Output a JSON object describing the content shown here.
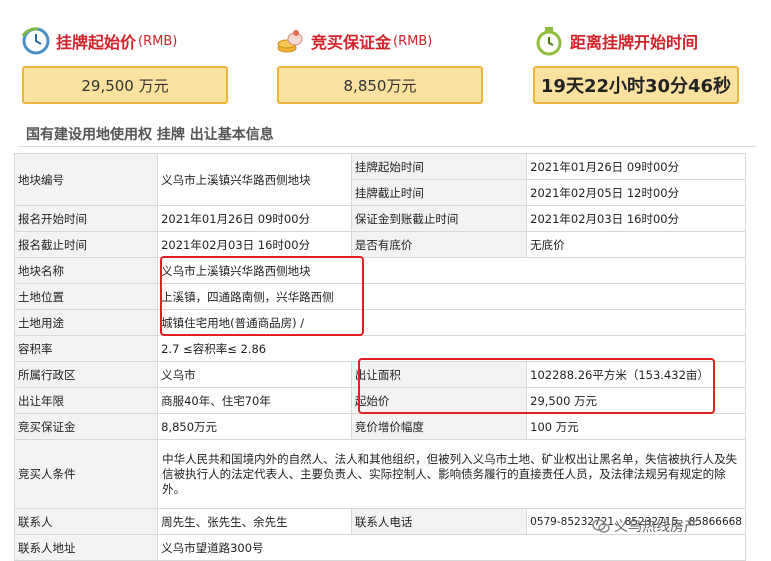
{
  "cards": [
    {
      "title": "挂牌起始价",
      "unit": "(RMB)",
      "value": "29,500  万元",
      "icon": "clock-icon"
    },
    {
      "title": "竞买保证金",
      "unit": "(RMB)",
      "value": "8,850万元",
      "icon": "coins-icon"
    },
    {
      "title": "距离挂牌开始时间",
      "unit": "",
      "value": "19天22小时30分46秒",
      "icon": "alarm-clock-icon"
    }
  ],
  "section_title": "国有建设用地使用权 挂牌 出让基本信息",
  "rows": {
    "r1": {
      "l1": "地块编号",
      "v1": "义乌市上溪镇兴华路西侧地块",
      "l2": "挂牌起始时间",
      "v2": "2021年01月26日 09时00分"
    },
    "r2": {
      "l2": "挂牌截止时间",
      "v2": "2021年02月05日 12时00分"
    },
    "r3": {
      "l1": "报名开始时间",
      "v1": "2021年01月26日 09时00分",
      "l2": "保证金到账截止时间",
      "v2": "2021年02月03日 16时00分"
    },
    "r4": {
      "l1": "报名截止时间",
      "v1": "2021年02月03日 16时00分",
      "l2": "是否有底价",
      "v2": "无底价"
    },
    "r5": {
      "l1": "地块名称",
      "v1": "义乌市上溪镇兴华路西侧地块"
    },
    "r6": {
      "l1": "土地位置",
      "v1": "上溪镇，四通路南侧，兴华路西侧"
    },
    "r7": {
      "l1": "土地用途",
      "v1": "城镇住宅用地(普通商品房) /"
    },
    "r8": {
      "l1": "容积率",
      "v1": "2.7 ≤容积率≤ 2.86"
    },
    "r9": {
      "l1": "所属行政区",
      "v1": "义乌市",
      "l2": "出让面积",
      "v2": "102288.26平方米（153.432亩）"
    },
    "r10": {
      "l1": "出让年限",
      "v1": "商服40年、住宅70年",
      "l2": "起始价",
      "v2": "29,500  万元"
    },
    "r11": {
      "l1": "竞买保证金",
      "v1": "8,850万元",
      "l2": "竞价增价幅度",
      "v2": "100 万元"
    },
    "r12": {
      "l1": "竞买人条件",
      "v1": "中华人民共和国境内外的自然人、法人和其他组织，但被列入义乌市土地、矿业权出让黑名单，失信被执行人及失信被执行人的法定代表人、主要负责人、实际控制人、影响债务履行的直接责任人员，及法律法规另有规定的除外。"
    },
    "r13": {
      "l1": "联系人",
      "v1": "周先生、张先生、余先生",
      "l2": "联系人电话",
      "v2": "0579-85232721、85232715、85866668"
    },
    "r14": {
      "l1": "联系人地址",
      "v1": "义乌市望道路300号"
    }
  },
  "watermark": "义乌热线房产",
  "colors": {
    "accent_red": "#d2232a",
    "box_fill": "#fbe2a0",
    "box_border": "#f0b43c",
    "highlight": "#e02020"
  }
}
